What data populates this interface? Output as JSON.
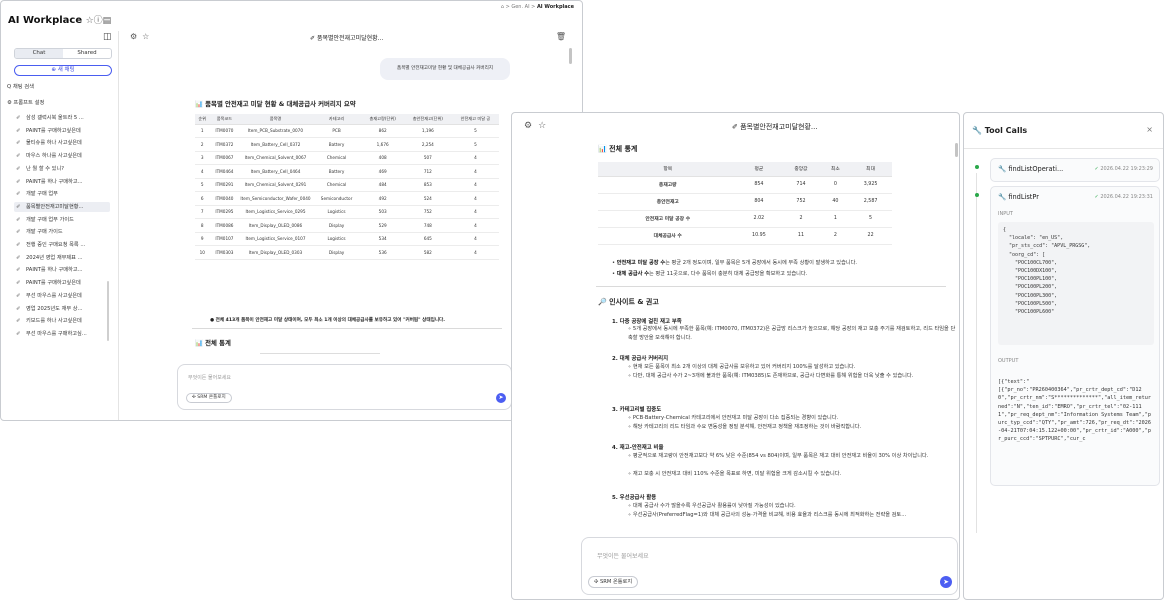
{
  "win1": {
    "breadcrumb": {
      "home": "⌂",
      "a": "Gen. AI",
      "b": "AI Workplace"
    },
    "app_title": "AI Workplace",
    "title_icons": "☆ⓘ▤",
    "sidebar": {
      "panel_icon": "◫",
      "tabs": [
        "Chat",
        "Shared"
      ],
      "new_chat": "⊕ 새 채팅",
      "search": "Q 채팅 검색",
      "prompt_settings": "⚙ 프롬프트 설정",
      "items": [
        "삼성 갤럭시북 울트라 5 ...",
        "PAINT를 구매하고싶은데",
        "물티슈를 하나 사고싶은데",
        "마우스 하나를 사고싶은데",
        "난 뭘 할 수 있니?",
        "PAINT를 하나 구매하고...",
        "개발 구매 업무",
        "품목별안전재고미달현황...",
        "개발 구매 업무 가이드",
        "개발 구매 가이드",
        "전행 중인 구매요청 목록 ...",
        "2024년 영업 재무제표 ...",
        "PAINT를 하나 구매하고...",
        "PAINT를 구매하고싶은데",
        "무선 마우스를 사고싶은데",
        "영업 2025년도 재무 상...",
        "키보드를 하나 사고싶은데",
        "무선 마우스를 구매하고싶..."
      ]
    },
    "main": {
      "toolbar_icons": "⚙☆",
      "chat_title": "품목별안전재고미달현황...",
      "trash": "🗑",
      "user_bubble": "품목별 안전재고미달 현황 및 대체공급사 커버리지",
      "summary_title": "📊 품목별 안전재고 미달 현황 & 대체공급사 커버리지 요약",
      "table": {
        "headers": [
          "순위",
          "품목코드",
          "품목명",
          "카테고리",
          "총재고량(단위)",
          "총안전재고(단위)",
          "안전재고 미달 공"
        ],
        "rows": [
          [
            "1",
            "ITM0070",
            "Item_PCB_Substrate_0070",
            "PCB",
            "862",
            "1,196",
            "5"
          ],
          [
            "2",
            "ITM0372",
            "Item_Battery_Cell_0372",
            "Battery",
            "1,676",
            "2,254",
            "5"
          ],
          [
            "3",
            "ITM0067",
            "Item_Chemical_Solvent_0067",
            "Chemical",
            "408",
            "507",
            "4"
          ],
          [
            "4",
            "ITM0464",
            "Item_Battery_Cell_0464",
            "Battery",
            "469",
            "712",
            "4"
          ],
          [
            "5",
            "ITM0291",
            "Item_Chemical_Solvent_0291",
            "Chemical",
            "484",
            "853",
            "4"
          ],
          [
            "6",
            "ITM0040",
            "Item_Semiconductor_Wafer_0040",
            "Semiconductor",
            "492",
            "524",
            "4"
          ],
          [
            "7",
            "ITM0295",
            "Item_Logistics_Service_0295",
            "Logistics",
            "503",
            "752",
            "4"
          ],
          [
            "8",
            "ITM0086",
            "Item_Display_OLED_0086",
            "Display",
            "529",
            "748",
            "4"
          ],
          [
            "9",
            "ITM0107",
            "Item_Logistics_Service_0107",
            "Logistics",
            "534",
            "645",
            "4"
          ],
          [
            "10",
            "ITM0303",
            "Item_Display_OLED_0303",
            "Display",
            "536",
            "582",
            "4"
          ]
        ]
      },
      "note": "● 전체 413개 품목이 안전재고 미달 상태이며, 모두 최소 1개 이상의 대체공급사를 보유하고 있어 \"커버됨\" 상태입니다.",
      "stats_title": "📊 전체 통계",
      "input_placeholder": "무엇이든 물어보세요",
      "chip": "✣ SRM 온톨로지",
      "send": "➤"
    }
  },
  "win2": {
    "toolbar_icons": "⚙☆",
    "chat_title": "✐ 품목별안전재고미달현황...",
    "stats_title": "📊 전체 통계",
    "stats": {
      "headers": [
        "항목",
        "평균",
        "중앙값",
        "최소",
        "최대"
      ],
      "rows": [
        [
          "총재고량",
          "854",
          "714",
          "0",
          "3,925"
        ],
        [
          "총안전재고",
          "804",
          "752",
          "40",
          "2,587"
        ],
        [
          "안전재고 미달 공장 수",
          "2.02",
          "2",
          "1",
          "5"
        ],
        [
          "대체공급사 수",
          "10.95",
          "11",
          "2",
          "22"
        ]
      ]
    },
    "bullets": [
      {
        "b": "안전재고 미달 공장 수",
        "t": "는 평균 2개 정도이며, 일부 품목은 5개 공장에서 동시에 부족 상황이 발생하고 있습니다."
      },
      {
        "b": "대체 공급사 수",
        "t": "는 평균 11곳으로, 다수 품목이 충분히 대체 공급망을 확보하고 있습니다."
      }
    ],
    "insight_title": "🔎 인사이트 & 권고",
    "insights": [
      {
        "h": "1. 다중 공장에 걸친 재고 부족",
        "s": [
          "5개 공장에서 동시에 부족한 품목(예: ITM0070, ITM0372)은 공급망 리스크가 높으므로, 해당 공장의 재고 보충 주기를 재검토하고, 리드 타임을 단축할 방안을 모색해야 합니다."
        ]
      },
      {
        "h": "2. 대체 공급사 커버리지",
        "s": [
          "현재 모든 품목이 최소 2개 이상의 대체 공급사를 보유하고 있어 커버리지 100%를 달성하고 있습니다.",
          "다만, 대체 공급사 수가 2~3개에 불과한 품목(예: ITM0385)도 존재하므로, 공급사 다변화를 통해 위험을 더욱 낮출 수 있습니다."
        ]
      },
      {
        "h": "3. 카테고리별 집중도",
        "s": [
          "PCB·Battery·Chemical 카테고리에서 안전재고 미달 공장이 다소 집중되는 경향이 있습니다.",
          "해당 카테고리의 리드 타임과 수요 변동성을 정밀 분석해, 안전재고 정책을 재조정하는 것이 바람직합니다."
        ]
      },
      {
        "h": "4. 재고-안전재고 비율",
        "s": [
          "평균적으로 재고량이 안전재고보다 약 6% 낮은 수준(854 vs 804)이며, 일부 품목은 재고 대비 안전재고 비율이 30% 이상 차이납니다.",
          "재고 보충 시 안전재고 대비 110% 수준을 목표로 하면, 미달 위험을 크게 감소시킬 수 있습니다."
        ]
      },
      {
        "h": "5. 우선공급사 활용",
        "s": [
          "대체 공급사 수가 많을수록 우선공급사 활용률이 낮아질 가능성이 있습니다.",
          "우선공급사(PreferredFlag=1)와 대체 공급사의 성능·가격을 비교해, 비용 효율과 리스크를 동시에 최적화하는 전략을 검토..."
        ]
      }
    ],
    "input_placeholder": "무엇이든 물어보세요",
    "chip": "✣ SRM 온톨로지",
    "send": "➤"
  },
  "tools": {
    "title": "Tool Calls",
    "close": "×",
    "calls": [
      {
        "name": "findListOperati...",
        "time": "2026.04.22 19:23:29"
      },
      {
        "name": "findListPr",
        "time": "2026.04.22 19:23:31"
      }
    ],
    "input_label": "INPUT",
    "input_code": "{\n  \"locale\": \"en_US\",\n  \"pr_sts_ccd\": \"APVL_PRGSG\",\n  \"oorg_cd\": [\n    \"POC100CL700\",\n    \"POC100DX100\",\n    \"POC100PL100\",\n    \"POC100PL200\",\n    \"POC100PL300\",\n    \"POC100PL500\",\n    \"POC100PL600\"",
    "output_label": "OUTPUT",
    "output_code": "[{\"text\":\"\n[{\"pr_no\":\"PR260400364\",\"pr_crtr_dept_cd\":\"D120\",\"pr_crtr_nm\":\"S**************\",\"all_item_returned\":\"N\",\"ten_id\":\"EMRO\",\"pr_crtr_tel\":\"02-1111\",\"pr_req_dept_nm\":\"Information Systems Team\",\"purc_typ_ccd\":\"QTY\",\"pr_amt\":726,\"pr_req_dt\":\"2026-04-21T07:04:15.122+00:00\",\"pr_crtr_id\":\"A000\",\"pr_purc_ccd\":\"SPTPURC\",\"cur_c"
  }
}
